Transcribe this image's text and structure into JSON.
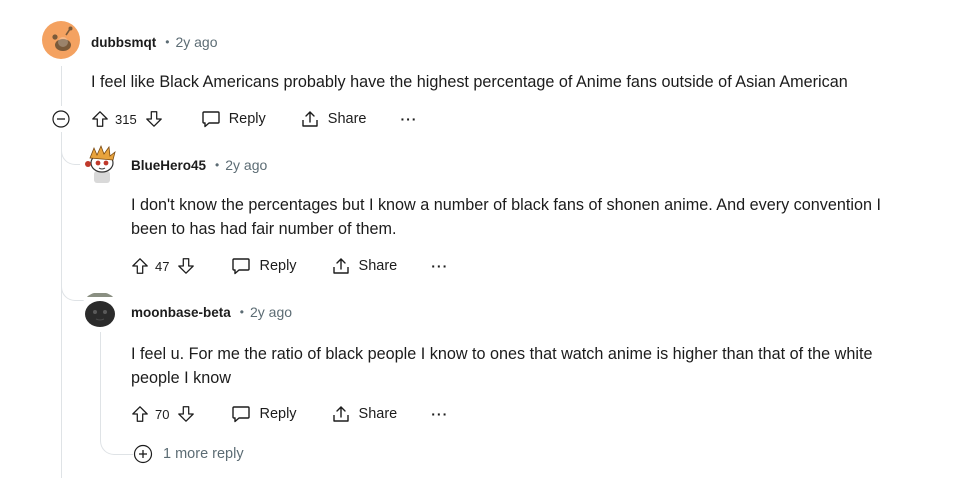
{
  "comments": [
    {
      "author": "dubbsmqt",
      "separator": "•",
      "time": "2y ago",
      "text": "I feel like Black Americans probably have the highest percentage of Anime fans outside of Asian American",
      "votes": "315",
      "reply_label": "Reply",
      "share_label": "Share",
      "more_label": "···"
    },
    {
      "author": "BlueHero45",
      "separator": "•",
      "time": "2y ago",
      "text_lines": [
        "I don't know the percentages but I know a number of black fans of shonen anime. And every convention I",
        "been to has had fair number of them."
      ],
      "votes": "47",
      "reply_label": "Reply",
      "share_label": "Share",
      "more_label": "···"
    },
    {
      "author": "moonbase-beta",
      "separator": "•",
      "time": "2y ago",
      "text_lines": [
        "I feel u. For me the ratio of black people I know to ones that watch anime is higher than that of the white",
        "people I know"
      ],
      "votes": "70",
      "reply_label": "Reply",
      "share_label": "Share",
      "more_label": "···"
    }
  ],
  "more_replies_label": "1 more reply",
  "colors": {
    "meta_gray": "#5c6c74",
    "thread_line": "#dfe3e6",
    "avatar_orange": "#f4a261"
  }
}
